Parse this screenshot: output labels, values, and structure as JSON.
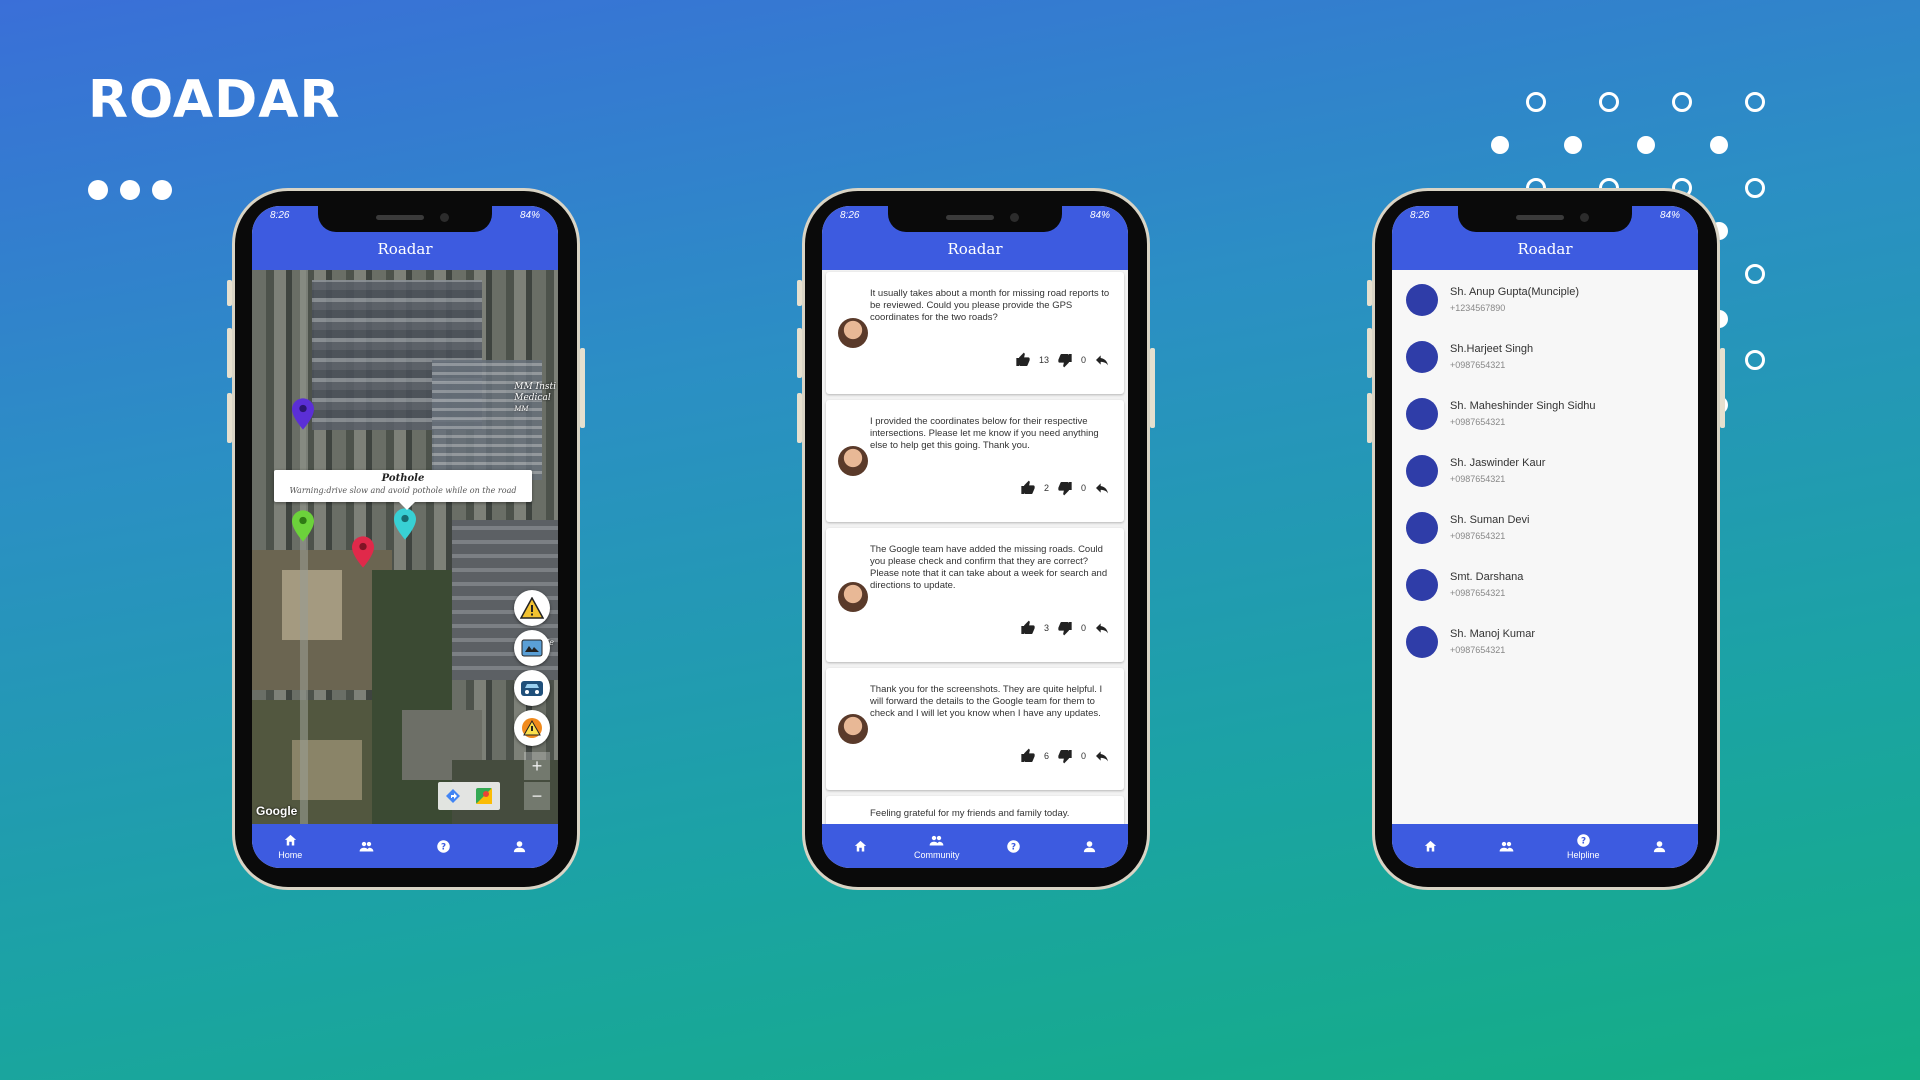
{
  "brand": {
    "title": "ROADAR"
  },
  "app": {
    "title": "Roadar",
    "status_time": "8:26",
    "status_battery": "84%"
  },
  "nav": {
    "home": "Home",
    "community": "Community",
    "helpline": "Helpline"
  },
  "map": {
    "callout_title": "Pothole",
    "callout_text": "Warning:drive slow and avoid pothole while on the road",
    "place_label_1": "MM Insti",
    "place_label_2": "Medical",
    "place_label_3": "MM",
    "place_label_4": "Me",
    "attribution": "Google",
    "zoom_in": "+",
    "zoom_out": "−",
    "pins": [
      {
        "color": "#5b2fd6",
        "name": "purple"
      },
      {
        "color": "#6cd23b",
        "name": "green"
      },
      {
        "color": "#e0294a",
        "name": "red"
      },
      {
        "color": "#38d0d4",
        "name": "cyan"
      }
    ],
    "fab_icons": [
      "warning-sign-icon",
      "roadwork-icon",
      "car-icon",
      "hazard-icon"
    ]
  },
  "community": {
    "posts": [
      {
        "text": "It usually takes about a month for missing road reports to be reviewed. Could you please provide the GPS coordinates for the two roads?",
        "likes": "13",
        "dislikes": "0"
      },
      {
        "text": "I provided the coordinates below for their respective intersections. Please let me know if you need anything else to help get this going. Thank you.",
        "likes": "2",
        "dislikes": "0"
      },
      {
        "text": "The Google team have added the missing roads. Could you please check and confirm that they are correct? Please note that it can take about a week for search and directions to update.",
        "likes": "3",
        "dislikes": "0"
      },
      {
        "text": "Thank you for the screenshots. They are quite helpful. I will forward the details to the Google team for them to check and I will let you know when I have any updates.",
        "likes": "6",
        "dislikes": "0"
      },
      {
        "text": "Feeling grateful for my friends and family today."
      }
    ]
  },
  "helpline": {
    "contacts": [
      {
        "name": "Sh. Anup Gupta(Munciple)",
        "phone": "+1234567890"
      },
      {
        "name": "Sh.Harjeet Singh",
        "phone": "+0987654321"
      },
      {
        "name": "Sh. Maheshinder Singh Sidhu",
        "phone": "+0987654321"
      },
      {
        "name": "Sh. Jaswinder Kaur",
        "phone": "+0987654321"
      },
      {
        "name": "Sh. Suman Devi",
        "phone": "+0987654321"
      },
      {
        "name": "Smt. Darshana",
        "phone": "+0987654321"
      },
      {
        "name": "Sh. Manoj Kumar",
        "phone": "+0987654321"
      }
    ]
  },
  "colors": {
    "accent": "#3d5be0",
    "avatar_dot": "#2f3da8"
  }
}
